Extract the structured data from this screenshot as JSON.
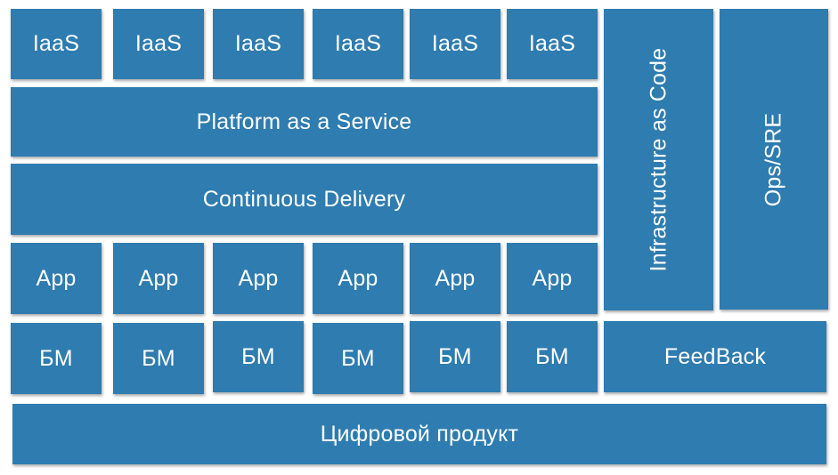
{
  "accent_color": "#2e7cb0",
  "iaas": [
    "IaaS",
    "IaaS",
    "IaaS",
    "IaaS",
    "IaaS",
    "IaaS"
  ],
  "paas": "Platform as a Service",
  "cd": "Continuous Delivery",
  "apps": [
    "App",
    "App",
    "App",
    "App",
    "App",
    "App"
  ],
  "bm": [
    "БМ",
    "БМ",
    "БМ",
    "БМ",
    "БМ",
    "БМ"
  ],
  "iac": "Infrastructure as Code",
  "ops": "Ops/SRE",
  "feedback": "FeedBack",
  "product": "Цифровой продукт"
}
